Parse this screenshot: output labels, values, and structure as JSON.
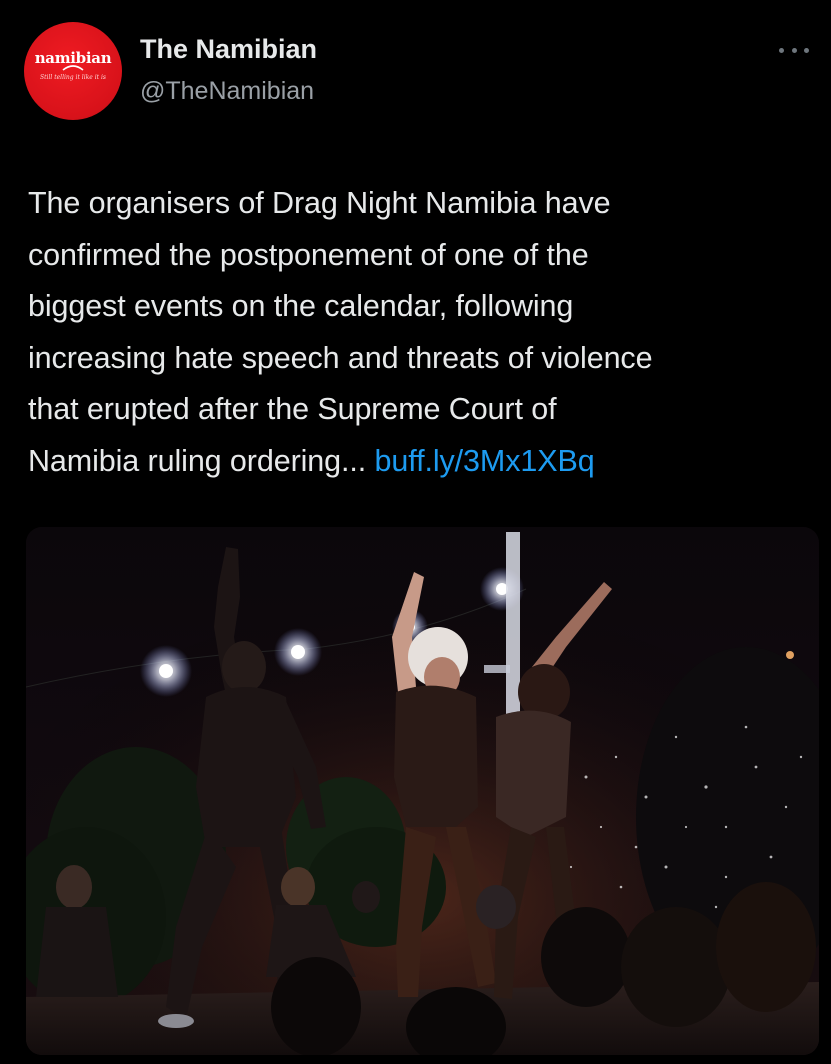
{
  "account": {
    "display_name": "The Namibian",
    "handle": "@TheNamibian",
    "avatar_logo_text": "namibian",
    "avatar_tagline": "Still telling it like it is"
  },
  "tweet": {
    "lines": [
      "The organisers of Drag Night Namibia have",
      "confirmed the postponement of one of the",
      "biggest events on the calendar, following",
      "increasing hate speech and threats of violence",
      "that erupted after the Supreme Court of",
      "Namibia ruling ordering..."
    ],
    "link_text": "buff.ly/3Mx1XBq"
  },
  "colors": {
    "background": "#000000",
    "text": "#e7e9ea",
    "secondary_text": "#9aa0a6",
    "link": "#1d9bf0",
    "avatar_red": "#d8121a"
  },
  "icons": {
    "more": "more-horizontal-icon"
  }
}
